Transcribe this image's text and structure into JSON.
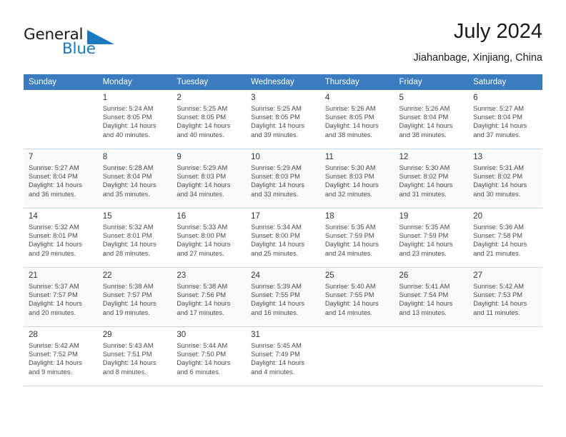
{
  "logo": {
    "word_one": "General",
    "word_two": "Blue",
    "triangle_icon": "triangle-icon",
    "blue_color": "#1c79c0"
  },
  "header": {
    "title": "July 2024",
    "subtitle": "Jiahanbage, Xinjiang, China"
  },
  "calendar": {
    "header_background": "#3b7cc0",
    "weekdays": [
      "Sunday",
      "Monday",
      "Tuesday",
      "Wednesday",
      "Thursday",
      "Friday",
      "Saturday"
    ],
    "weeks": [
      [
        {
          "day": "",
          "sunrise": "",
          "sunset": "",
          "daylight1": "",
          "daylight2": ""
        },
        {
          "day": "1",
          "sunrise": "Sunrise: 5:24 AM",
          "sunset": "Sunset: 8:05 PM",
          "daylight1": "Daylight: 14 hours",
          "daylight2": "and 40 minutes."
        },
        {
          "day": "2",
          "sunrise": "Sunrise: 5:25 AM",
          "sunset": "Sunset: 8:05 PM",
          "daylight1": "Daylight: 14 hours",
          "daylight2": "and 40 minutes."
        },
        {
          "day": "3",
          "sunrise": "Sunrise: 5:25 AM",
          "sunset": "Sunset: 8:05 PM",
          "daylight1": "Daylight: 14 hours",
          "daylight2": "and 39 minutes."
        },
        {
          "day": "4",
          "sunrise": "Sunrise: 5:26 AM",
          "sunset": "Sunset: 8:05 PM",
          "daylight1": "Daylight: 14 hours",
          "daylight2": "and 38 minutes."
        },
        {
          "day": "5",
          "sunrise": "Sunrise: 5:26 AM",
          "sunset": "Sunset: 8:04 PM",
          "daylight1": "Daylight: 14 hours",
          "daylight2": "and 38 minutes."
        },
        {
          "day": "6",
          "sunrise": "Sunrise: 5:27 AM",
          "sunset": "Sunset: 8:04 PM",
          "daylight1": "Daylight: 14 hours",
          "daylight2": "and 37 minutes."
        }
      ],
      [
        {
          "day": "7",
          "sunrise": "Sunrise: 5:27 AM",
          "sunset": "Sunset: 8:04 PM",
          "daylight1": "Daylight: 14 hours",
          "daylight2": "and 36 minutes."
        },
        {
          "day": "8",
          "sunrise": "Sunrise: 5:28 AM",
          "sunset": "Sunset: 8:04 PM",
          "daylight1": "Daylight: 14 hours",
          "daylight2": "and 35 minutes."
        },
        {
          "day": "9",
          "sunrise": "Sunrise: 5:29 AM",
          "sunset": "Sunset: 8:03 PM",
          "daylight1": "Daylight: 14 hours",
          "daylight2": "and 34 minutes."
        },
        {
          "day": "10",
          "sunrise": "Sunrise: 5:29 AM",
          "sunset": "Sunset: 8:03 PM",
          "daylight1": "Daylight: 14 hours",
          "daylight2": "and 33 minutes."
        },
        {
          "day": "11",
          "sunrise": "Sunrise: 5:30 AM",
          "sunset": "Sunset: 8:03 PM",
          "daylight1": "Daylight: 14 hours",
          "daylight2": "and 32 minutes."
        },
        {
          "day": "12",
          "sunrise": "Sunrise: 5:30 AM",
          "sunset": "Sunset: 8:02 PM",
          "daylight1": "Daylight: 14 hours",
          "daylight2": "and 31 minutes."
        },
        {
          "day": "13",
          "sunrise": "Sunrise: 5:31 AM",
          "sunset": "Sunset: 8:02 PM",
          "daylight1": "Daylight: 14 hours",
          "daylight2": "and 30 minutes."
        }
      ],
      [
        {
          "day": "14",
          "sunrise": "Sunrise: 5:32 AM",
          "sunset": "Sunset: 8:01 PM",
          "daylight1": "Daylight: 14 hours",
          "daylight2": "and 29 minutes."
        },
        {
          "day": "15",
          "sunrise": "Sunrise: 5:32 AM",
          "sunset": "Sunset: 8:01 PM",
          "daylight1": "Daylight: 14 hours",
          "daylight2": "and 28 minutes."
        },
        {
          "day": "16",
          "sunrise": "Sunrise: 5:33 AM",
          "sunset": "Sunset: 8:00 PM",
          "daylight1": "Daylight: 14 hours",
          "daylight2": "and 27 minutes."
        },
        {
          "day": "17",
          "sunrise": "Sunrise: 5:34 AM",
          "sunset": "Sunset: 8:00 PM",
          "daylight1": "Daylight: 14 hours",
          "daylight2": "and 25 minutes."
        },
        {
          "day": "18",
          "sunrise": "Sunrise: 5:35 AM",
          "sunset": "Sunset: 7:59 PM",
          "daylight1": "Daylight: 14 hours",
          "daylight2": "and 24 minutes."
        },
        {
          "day": "19",
          "sunrise": "Sunrise: 5:35 AM",
          "sunset": "Sunset: 7:59 PM",
          "daylight1": "Daylight: 14 hours",
          "daylight2": "and 23 minutes."
        },
        {
          "day": "20",
          "sunrise": "Sunrise: 5:36 AM",
          "sunset": "Sunset: 7:58 PM",
          "daylight1": "Daylight: 14 hours",
          "daylight2": "and 21 minutes."
        }
      ],
      [
        {
          "day": "21",
          "sunrise": "Sunrise: 5:37 AM",
          "sunset": "Sunset: 7:57 PM",
          "daylight1": "Daylight: 14 hours",
          "daylight2": "and 20 minutes."
        },
        {
          "day": "22",
          "sunrise": "Sunrise: 5:38 AM",
          "sunset": "Sunset: 7:57 PM",
          "daylight1": "Daylight: 14 hours",
          "daylight2": "and 19 minutes."
        },
        {
          "day": "23",
          "sunrise": "Sunrise: 5:38 AM",
          "sunset": "Sunset: 7:56 PM",
          "daylight1": "Daylight: 14 hours",
          "daylight2": "and 17 minutes."
        },
        {
          "day": "24",
          "sunrise": "Sunrise: 5:39 AM",
          "sunset": "Sunset: 7:55 PM",
          "daylight1": "Daylight: 14 hours",
          "daylight2": "and 16 minutes."
        },
        {
          "day": "25",
          "sunrise": "Sunrise: 5:40 AM",
          "sunset": "Sunset: 7:55 PM",
          "daylight1": "Daylight: 14 hours",
          "daylight2": "and 14 minutes."
        },
        {
          "day": "26",
          "sunrise": "Sunrise: 5:41 AM",
          "sunset": "Sunset: 7:54 PM",
          "daylight1": "Daylight: 14 hours",
          "daylight2": "and 13 minutes."
        },
        {
          "day": "27",
          "sunrise": "Sunrise: 5:42 AM",
          "sunset": "Sunset: 7:53 PM",
          "daylight1": "Daylight: 14 hours",
          "daylight2": "and 11 minutes."
        }
      ],
      [
        {
          "day": "28",
          "sunrise": "Sunrise: 5:42 AM",
          "sunset": "Sunset: 7:52 PM",
          "daylight1": "Daylight: 14 hours",
          "daylight2": "and 9 minutes."
        },
        {
          "day": "29",
          "sunrise": "Sunrise: 5:43 AM",
          "sunset": "Sunset: 7:51 PM",
          "daylight1": "Daylight: 14 hours",
          "daylight2": "and 8 minutes."
        },
        {
          "day": "30",
          "sunrise": "Sunrise: 5:44 AM",
          "sunset": "Sunset: 7:50 PM",
          "daylight1": "Daylight: 14 hours",
          "daylight2": "and 6 minutes."
        },
        {
          "day": "31",
          "sunrise": "Sunrise: 5:45 AM",
          "sunset": "Sunset: 7:49 PM",
          "daylight1": "Daylight: 14 hours",
          "daylight2": "and 4 minutes."
        },
        {
          "day": "",
          "sunrise": "",
          "sunset": "",
          "daylight1": "",
          "daylight2": ""
        },
        {
          "day": "",
          "sunrise": "",
          "sunset": "",
          "daylight1": "",
          "daylight2": ""
        },
        {
          "day": "",
          "sunrise": "",
          "sunset": "",
          "daylight1": "",
          "daylight2": ""
        }
      ]
    ]
  }
}
